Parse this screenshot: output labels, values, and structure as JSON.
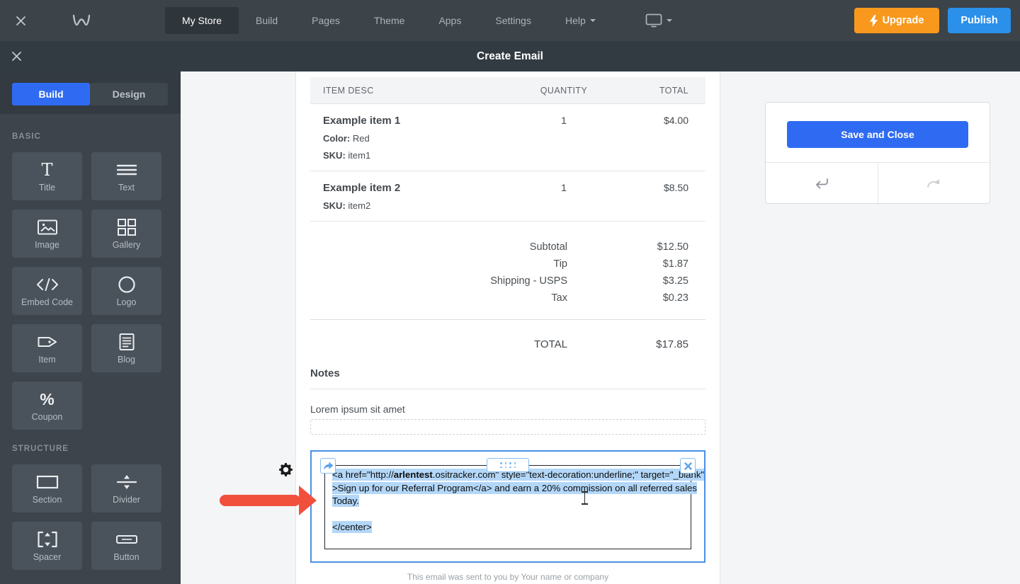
{
  "topnav": {
    "items": [
      "My Store",
      "Build",
      "Pages",
      "Theme",
      "Apps",
      "Settings",
      "Help"
    ],
    "active_item": "My Store",
    "upgrade_label": "Upgrade",
    "publish_label": "Publish"
  },
  "editor_bar": {
    "title": "Create Email"
  },
  "sidebar": {
    "tabs": {
      "build": "Build",
      "design": "Design"
    },
    "active_tab": "Build",
    "basic_label": "BASIC",
    "structure_label": "STRUCTURE",
    "basic_tiles": [
      {
        "label": "Title"
      },
      {
        "label": "Text"
      },
      {
        "label": "Image"
      },
      {
        "label": "Gallery"
      },
      {
        "label": "Embed Code"
      },
      {
        "label": "Logo"
      },
      {
        "label": "Item"
      },
      {
        "label": "Blog"
      },
      {
        "label": "Coupon"
      }
    ],
    "structure_tiles": [
      {
        "label": "Section"
      },
      {
        "label": "Divider"
      },
      {
        "label": "Spacer"
      },
      {
        "label": "Button"
      }
    ]
  },
  "email": {
    "table": {
      "col_item": "ITEM DESC",
      "col_qty": "QUANTITY",
      "col_total": "TOTAL",
      "rows": [
        {
          "name": "Example item 1",
          "line1_label": "Color:",
          "line1_value": "Red",
          "line2_label": "SKU:",
          "line2_value": "item1",
          "qty": "1",
          "total": "$4.00"
        },
        {
          "name": "Example item 2",
          "line1_label": "SKU:",
          "line1_value": "item2",
          "qty": "1",
          "total": "$8.50"
        }
      ]
    },
    "totals": [
      {
        "label": "Subtotal",
        "value": "$12.50"
      },
      {
        "label": "Tip",
        "value": "$1.87"
      },
      {
        "label": "Shipping - USPS",
        "value": "$3.25"
      },
      {
        "label": "Tax",
        "value": "$0.23"
      }
    ],
    "grand_total": {
      "label": "TOTAL",
      "value": "$17.85"
    },
    "notes": {
      "title": "Notes",
      "body": "Lorem ipsum sit amet"
    },
    "embed_code": {
      "line1_pre": "<a href=\"http://",
      "line1_bold": "arlentest",
      "line1_post": ".ositracker.com\" style=\"text-decoration:underline;\" target=\"_blank\"",
      "line2": ">Sign up for our Referral Program</a> and earn a 20% commission on all referred sales",
      "line3": "Today.",
      "line4": "</center>"
    },
    "footer": "This email was sent to you by Your name or company"
  },
  "panel": {
    "save_label": "Save and Close"
  },
  "colors": {
    "accent_blue": "#2f6bf2",
    "publish_blue": "#2a90ea",
    "upgrade_orange": "#f8991d",
    "selection_blue": "#b3d7f8",
    "arrow_red": "#f1503d",
    "embed_border": "#4a90e2"
  }
}
